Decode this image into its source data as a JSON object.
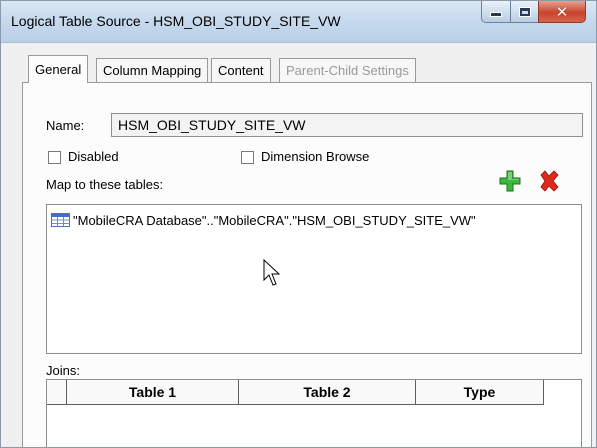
{
  "window": {
    "title": "Logical Table Source - HSM_OBI_STUDY_SITE_VW",
    "close_glyph": "✕"
  },
  "tabs": [
    {
      "label": "General",
      "active": true,
      "enabled": true
    },
    {
      "label": "Column Mapping",
      "active": false,
      "enabled": true
    },
    {
      "label": "Content",
      "active": false,
      "enabled": true
    },
    {
      "label": "Parent-Child Settings",
      "active": false,
      "enabled": false
    }
  ],
  "general": {
    "name_label": "Name:",
    "name_value": "HSM_OBI_STUDY_SITE_VW",
    "disabled_label": "Disabled",
    "disabled_checked": false,
    "dimension_browse_label": "Dimension Browse",
    "dimension_browse_checked": false,
    "map_tables_label": "Map to these tables:",
    "add_icon": "add-icon",
    "delete_icon": "delete-icon",
    "mapped_tables": [
      "\"MobileCRA Database\"..\"MobileCRA\".\"HSM_OBI_STUDY_SITE_VW\""
    ],
    "joins_label": "Joins:",
    "joins_columns": [
      "Table 1",
      "Table 2",
      "Type"
    ]
  },
  "colors": {
    "add_green": "#3cb83c",
    "delete_red": "#e0281c",
    "titlebar": "#c7daed"
  }
}
